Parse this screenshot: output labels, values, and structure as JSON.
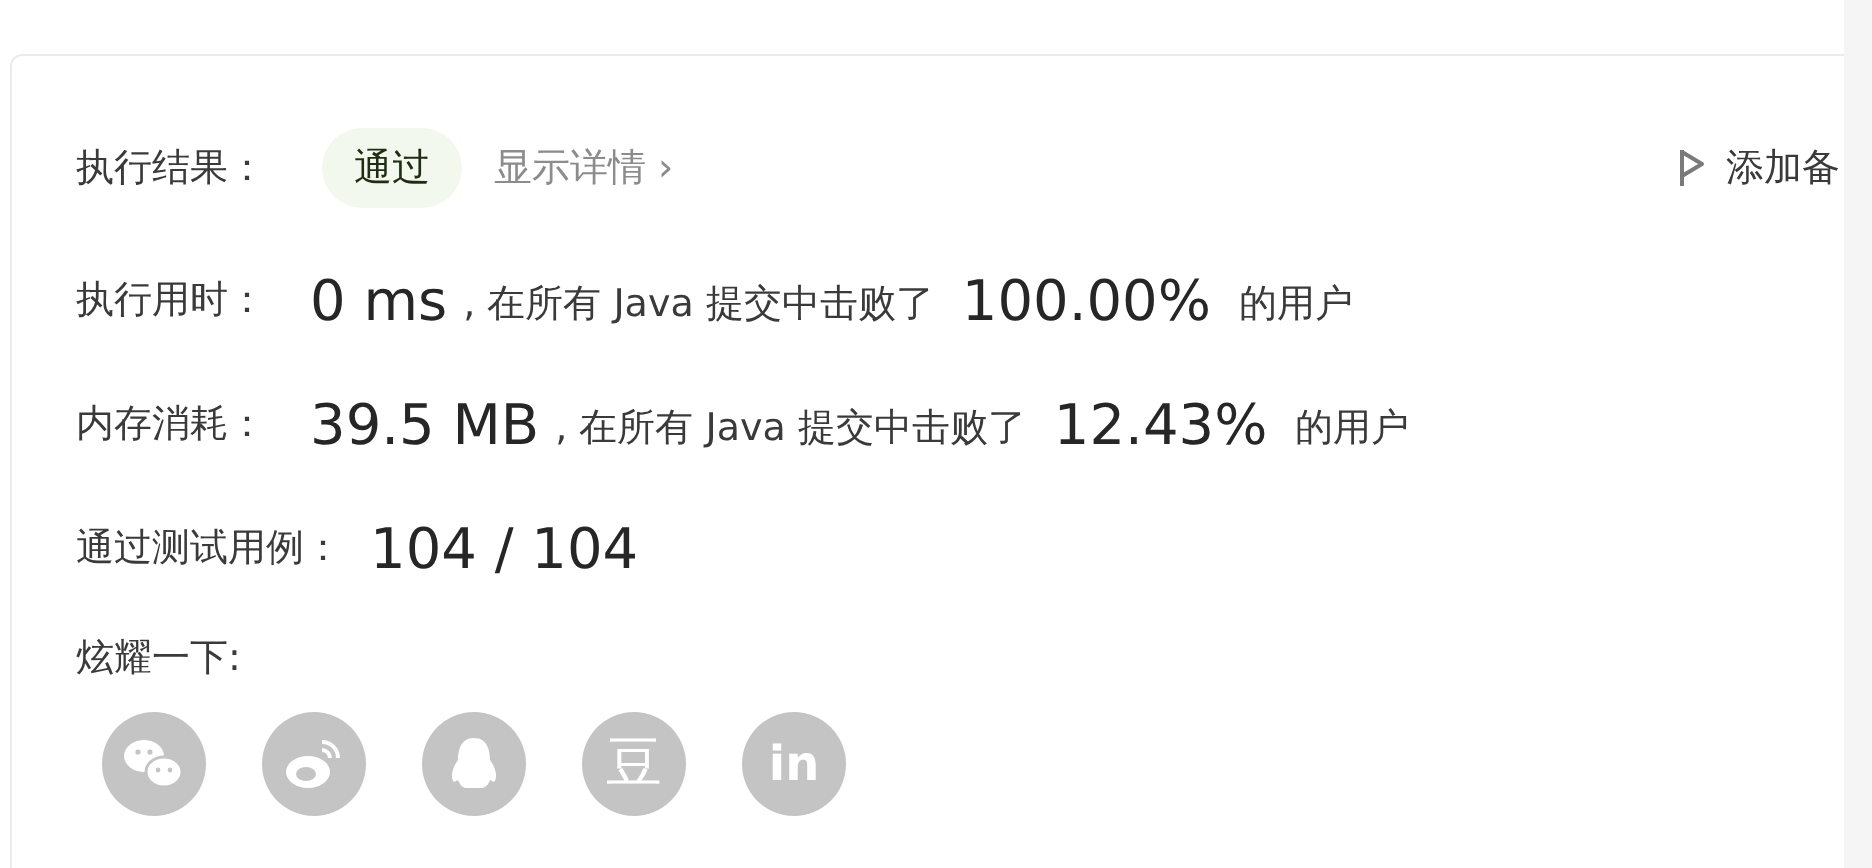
{
  "result": {
    "label": "执行结果：",
    "status": "通过",
    "details_link": "显示详情",
    "chevron": "›"
  },
  "note_button": "添加备",
  "stats": [
    {
      "label": "执行用时：",
      "value": "0 ms",
      "middle": ", 在所有 Java 提交中击败了",
      "percent": "100.00%",
      "suffix": "的用户"
    },
    {
      "label": "内存消耗：",
      "value": "39.5 MB",
      "middle": ", 在所有 Java 提交中击败了",
      "percent": "12.43%",
      "suffix": "的用户"
    }
  ],
  "tests": {
    "label": "通过测试用例：",
    "value": "104 / 104"
  },
  "share": {
    "label": "炫耀一下:",
    "buttons": [
      {
        "kind": "wechat"
      },
      {
        "kind": "weibo"
      },
      {
        "kind": "qq"
      },
      {
        "kind": "douban",
        "glyph": "豆"
      },
      {
        "kind": "linkedin",
        "glyph": "in"
      }
    ]
  }
}
